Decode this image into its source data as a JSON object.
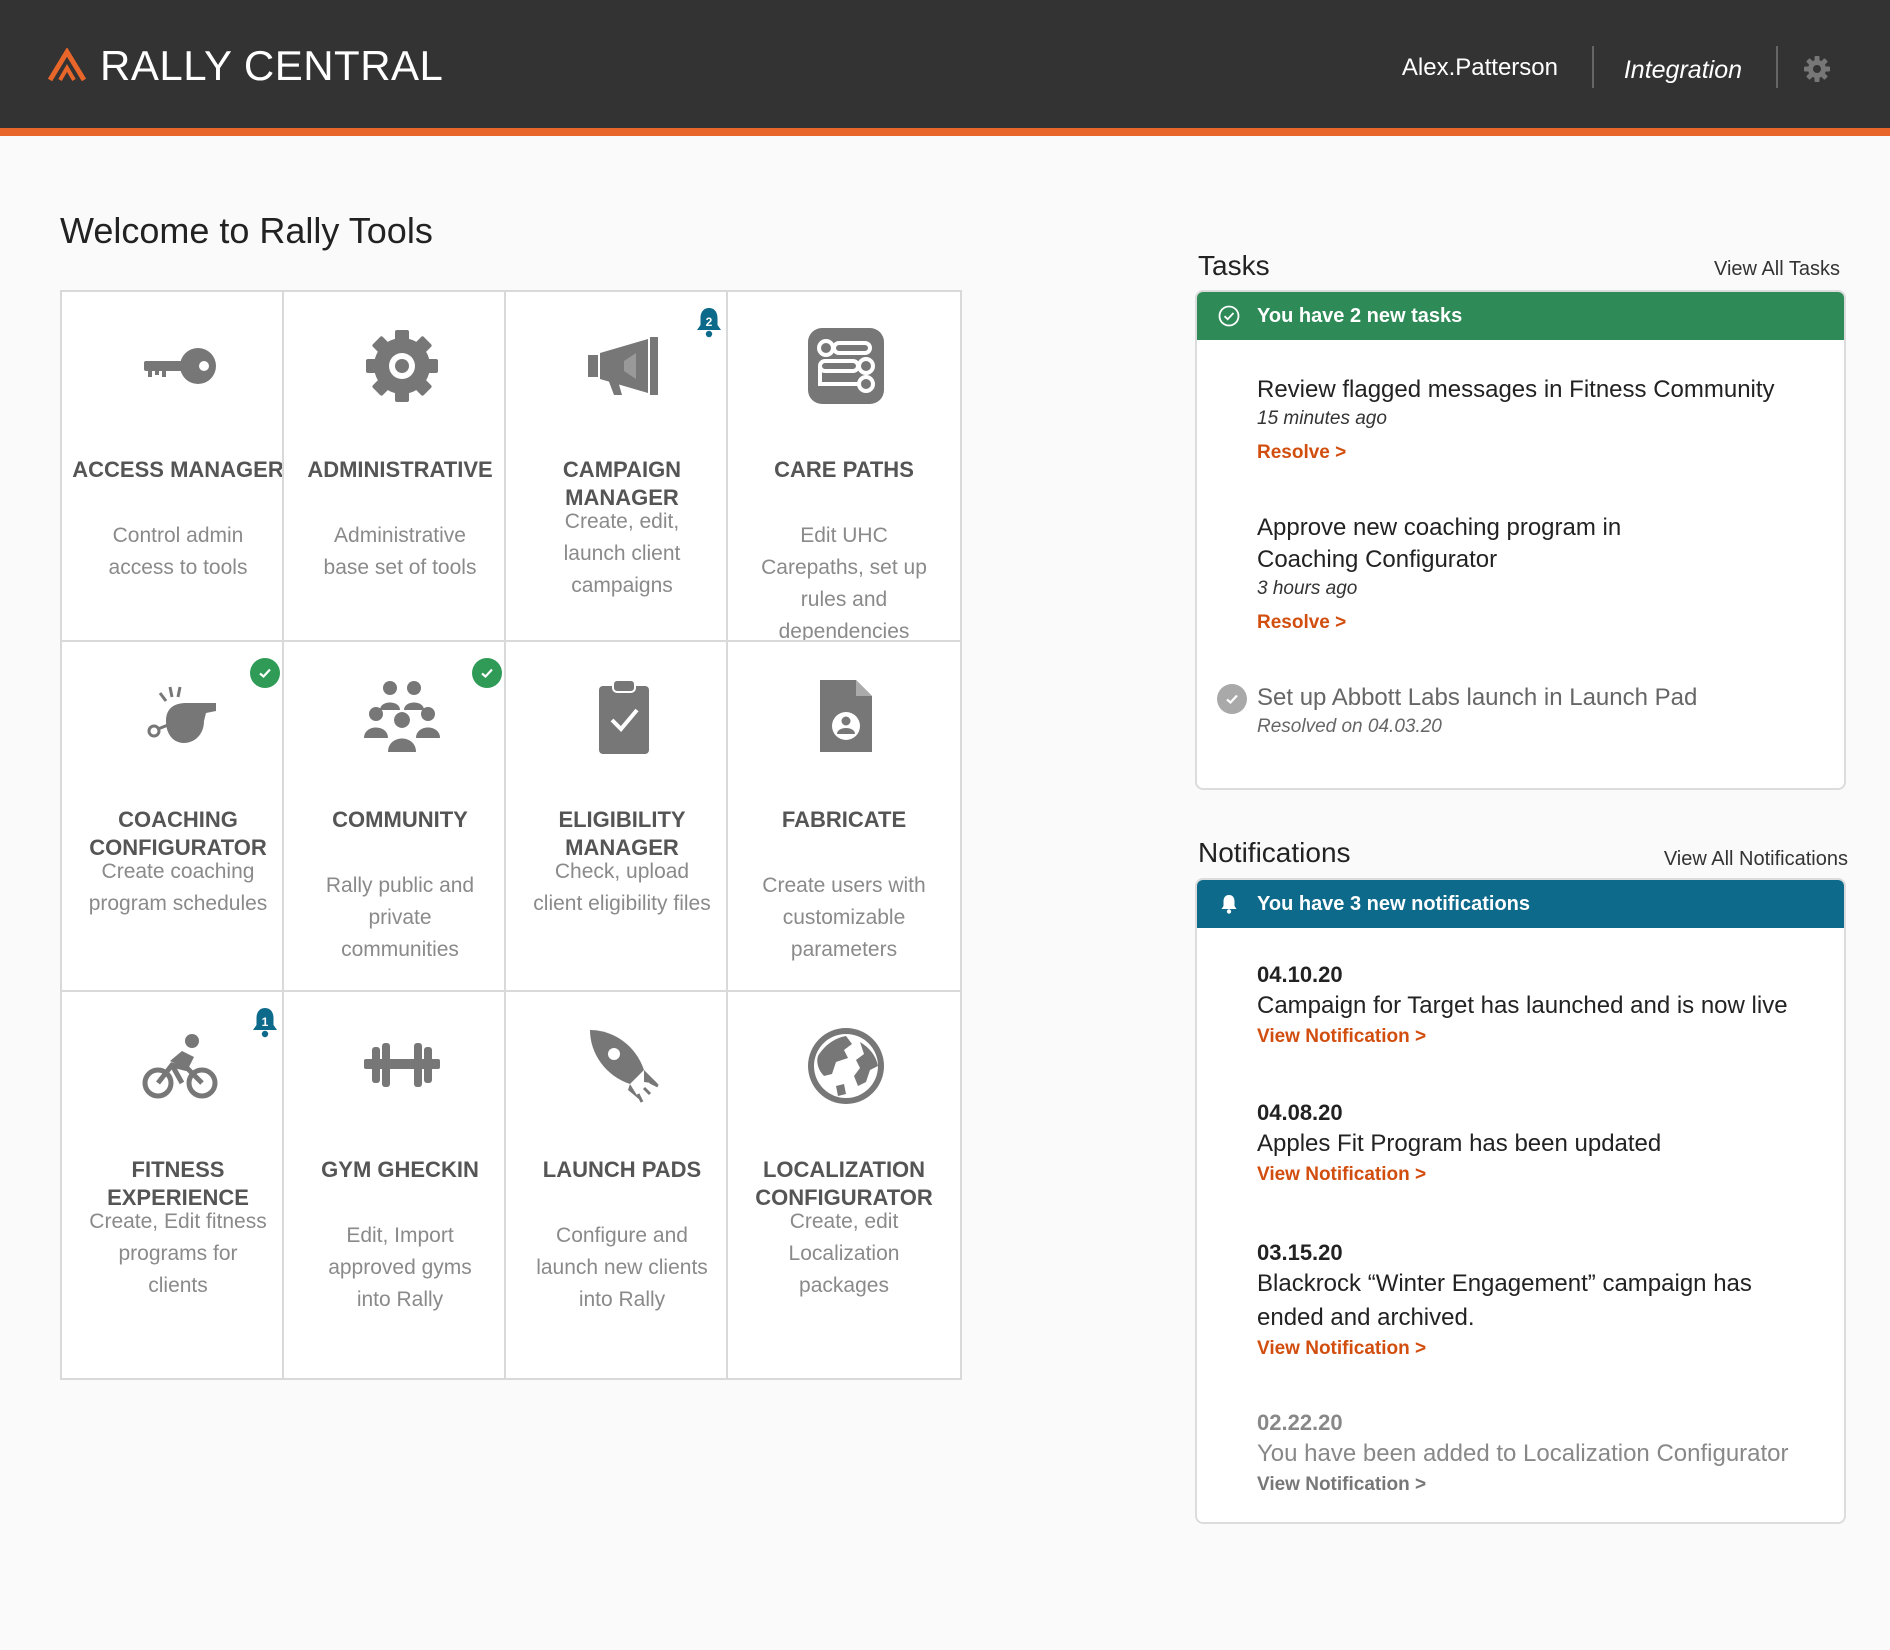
{
  "header": {
    "brand": "RALLY CENTRAL",
    "user": "Alex.Patterson",
    "environment": "Integration",
    "accent_color": "#e8662a",
    "bar_color": "#333333"
  },
  "welcome": "Welcome to Rally Tools",
  "tools": [
    {
      "title_lines": [
        "ACCESS MANAGER"
      ],
      "desc": [
        "Control admin",
        "access to tools"
      ],
      "icon": "key-icon",
      "badge": null
    },
    {
      "title_lines": [
        "ADMINISTRATIVE"
      ],
      "desc": [
        "Administrative",
        "base set of tools"
      ],
      "icon": "gear-icon",
      "badge": null
    },
    {
      "title_lines": [
        "CAMPAIGN",
        "MANAGER"
      ],
      "desc": [
        "Create, edit,",
        "launch client",
        "campaigns"
      ],
      "icon": "megaphone-icon",
      "badge": {
        "type": "bell",
        "count": "2"
      }
    },
    {
      "title_lines": [
        "CARE PATHS"
      ],
      "desc": [
        "Edit UHC",
        "Carepaths, set up",
        "rules and",
        "dependencies"
      ],
      "icon": "care-paths-icon",
      "badge": null
    },
    {
      "title_lines": [
        "COACHING",
        "CONFIGURATOR"
      ],
      "desc": [
        "Create coaching",
        "program schedules"
      ],
      "icon": "whistle-icon",
      "badge": {
        "type": "check"
      }
    },
    {
      "title_lines": [
        "COMMUNITY"
      ],
      "desc": [
        "Rally public and",
        "private",
        "communities"
      ],
      "icon": "people-icon",
      "badge": {
        "type": "check"
      }
    },
    {
      "title_lines": [
        "ELIGIBILITY",
        "MANAGER"
      ],
      "desc": [
        "Check, upload",
        "client eligibility files"
      ],
      "icon": "clipboard-check-icon",
      "badge": null
    },
    {
      "title_lines": [
        "FABRICATE"
      ],
      "desc": [
        "Create users with",
        "customizable",
        "parameters"
      ],
      "icon": "user-file-icon",
      "badge": null
    },
    {
      "title_lines": [
        "FITNESS",
        "EXPERIENCE"
      ],
      "desc": [
        "Create, Edit fitness",
        "programs for",
        "clients"
      ],
      "icon": "cyclist-icon",
      "badge": {
        "type": "bell",
        "count": "1"
      }
    },
    {
      "title_lines": [
        "GYM GHECKIN"
      ],
      "desc": [
        "Edit, Import",
        "approved gyms",
        "into Rally"
      ],
      "icon": "dumbbell-icon",
      "badge": null
    },
    {
      "title_lines": [
        "LAUNCH PADS"
      ],
      "desc": [
        "Configure and",
        "launch new clients",
        "into Rally"
      ],
      "icon": "rocket-icon",
      "badge": null
    },
    {
      "title_lines": [
        "LOCALIZATION",
        "CONFIGURATOR"
      ],
      "desc": [
        "Create, edit",
        "Localization",
        "packages"
      ],
      "icon": "globe-icon",
      "badge": null
    }
  ],
  "tasks": {
    "title": "Tasks",
    "view_all": "View All Tasks",
    "banner": "You have 2 new tasks",
    "banner_color": "#2e8b57",
    "items": [
      {
        "lines": [
          "Review flagged messages in Fitness Community"
        ],
        "time": "15 minutes ago",
        "action": "Resolve >"
      },
      {
        "lines": [
          "Approve new coaching program in",
          "Coaching Configurator"
        ],
        "time": "3 hours ago",
        "action": "Resolve >"
      },
      {
        "lines": [
          "Set up Abbott Labs launch in Launch Pad"
        ],
        "time": "Resolved on 04.03.20",
        "action": null
      }
    ]
  },
  "notifications": {
    "title": "Notifications",
    "view_all": "View All Notifications",
    "banner": "You have 3 new notifications",
    "banner_color": "#0d6a8a",
    "items": [
      {
        "date": "04.10.20",
        "lines": [
          "Campaign for Target has launched and is now live"
        ],
        "link": "View Notification >"
      },
      {
        "date": "04.08.20",
        "lines": [
          "Apples Fit Program has been updated"
        ],
        "link": "View Notification >"
      },
      {
        "date": "03.15.20",
        "lines": [
          "Blackrock “Winter Engagement” campaign has",
          "ended and archived."
        ],
        "link": "View Notification >"
      },
      {
        "date": "02.22.20",
        "lines": [
          "You have been added to Localization Configurator"
        ],
        "link": "View Notification >"
      }
    ]
  }
}
